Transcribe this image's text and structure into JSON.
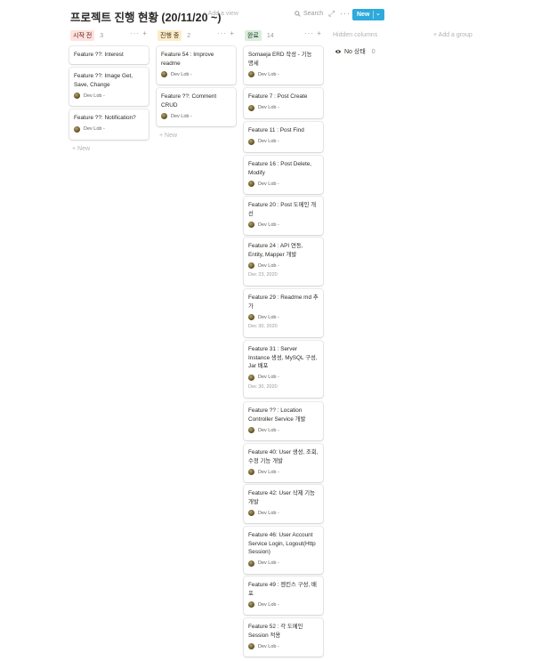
{
  "header": {
    "title": "프로젝트 진행 현황 (20/11/20 ~)",
    "add_view": "+ Add a view",
    "search": "Search",
    "new_button": "New"
  },
  "columns": [
    {
      "tag": "시작 전",
      "tag_bg": "#ffe2dd",
      "tag_color": "#5d1715",
      "count": "3",
      "cards": [
        {
          "title": "Feature ??: Interest",
          "person": "",
          "date": ""
        },
        {
          "title": "Feature ??: Image Get, Save, Change",
          "person": "Dev Lob -",
          "date": ""
        },
        {
          "title": "Feature ??: Notification?",
          "person": "Dev Lob -",
          "date": ""
        }
      ],
      "new_label": "+ New"
    },
    {
      "tag": "진행 중",
      "tag_bg": "#fdecc8",
      "tag_color": "#402c1b",
      "count": "2",
      "cards": [
        {
          "title": "Feature 54 : Improve readme",
          "person": "Dev Lob -",
          "date": ""
        },
        {
          "title": "Feature ??: Comment CRUD",
          "person": "Dev Lob -",
          "date": ""
        }
      ],
      "new_label": "+ New"
    },
    {
      "tag": "완료",
      "tag_bg": "#dbeddb",
      "tag_color": "#1c3829",
      "count": "14",
      "cards": [
        {
          "title": "Somaeja ERD 작성 - 기능 명세",
          "person": "Dev Lob -",
          "date": ""
        },
        {
          "title": "Feature 7 : Post Create",
          "person": "Dev Lob -",
          "date": ""
        },
        {
          "title": "Feature 11 : Post Find",
          "person": "Dev Lob -",
          "date": ""
        },
        {
          "title": "Feature 16 : Post Delete, Modify",
          "person": "Dev Lob -",
          "date": ""
        },
        {
          "title": "Feature 20 : Post 도메인 개선",
          "person": "Dev Lob -",
          "date": ""
        },
        {
          "title": "Feature 24 : API 연동, Entity, Mapper 개발",
          "person": "Dev Lob -",
          "date": "Dec 23, 2020"
        },
        {
          "title": "Feature 29 : Readme md 추가",
          "person": "Dev Lob -",
          "date": "Dec 30, 2020"
        },
        {
          "title": "Feature 31 : Server Instance 생성, MySQL 구성, Jar 배포",
          "person": "Dev Lob -",
          "date": "Dec 30, 2020"
        },
        {
          "title": "Feature ?? : Location Controller Service 개발",
          "person": "Dev Lob -",
          "date": ""
        },
        {
          "title": "Feature 40: User 생성, 조회, 수정 기능 개발",
          "person": "Dev Lob -",
          "date": ""
        },
        {
          "title": "Feature 42: User 삭제 기능 개발",
          "person": "Dev Lob -",
          "date": ""
        },
        {
          "title": "Feature 46: User Account Service Login, Logout(Http Session)",
          "person": "Dev Lob -",
          "date": ""
        },
        {
          "title": "Feature 49 : 젠킨스 구성, 배포",
          "person": "Dev Lob -",
          "date": ""
        },
        {
          "title": "Feature 52 : 각 도메인 Session 적용",
          "person": "Dev Lob -",
          "date": ""
        }
      ]
    }
  ],
  "hidden_columns": "Hidden columns",
  "add_group": "+ Add a group",
  "no_status": {
    "label": "No 상태",
    "count": "0"
  },
  "icons": {
    "search": "search-icon",
    "expand": "expand-icon",
    "more": "more-icon",
    "add": "plus-icon",
    "eye_off": "eye-off-icon"
  },
  "colors": {
    "accent": "#2eaadc"
  }
}
